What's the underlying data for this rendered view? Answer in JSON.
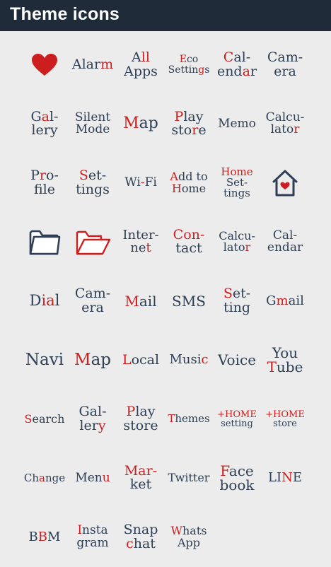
{
  "header": {
    "title": "Theme icons"
  },
  "colors": {
    "ink": "#2e3f55",
    "accent": "#cc1e1e",
    "bar": "#1f2b39",
    "background": "#ececec"
  },
  "grid": [
    {
      "name": "heart-icon",
      "type": "icon",
      "icon": "heart"
    },
    {
      "name": "alarm",
      "text": "Alarm",
      "lines": [
        [
          [
            "Alar",
            0
          ],
          [
            "m",
            1
          ]
        ]
      ],
      "size": 19
    },
    {
      "name": "all-apps",
      "text": "All Apps",
      "lines": [
        [
          [
            "A",
            0
          ],
          [
            "ll",
            1
          ]
        ],
        [
          [
            "Apps",
            0
          ]
        ]
      ],
      "size": 19
    },
    {
      "name": "eco-settings",
      "text": "Eco Settings",
      "lines": [
        [
          [
            "E",
            1
          ],
          [
            "co",
            0
          ]
        ],
        [
          [
            "Settin",
            0
          ],
          [
            "g",
            1
          ],
          [
            "s",
            0
          ]
        ]
      ],
      "size": 14
    },
    {
      "name": "calendar",
      "text": "Cal-endar",
      "lines": [
        [
          [
            "C",
            1
          ],
          [
            "al-",
            0
          ]
        ],
        [
          [
            "end",
            0
          ],
          [
            "a",
            1
          ],
          [
            "r",
            0
          ]
        ]
      ],
      "size": 19
    },
    {
      "name": "camera",
      "text": "Cam-era",
      "lines": [
        [
          [
            "Cam-",
            0
          ]
        ],
        [
          [
            "era",
            0
          ]
        ]
      ],
      "size": 19
    },
    {
      "name": "gallery",
      "text": "Gal-lery",
      "lines": [
        [
          [
            "G",
            0
          ],
          [
            "a",
            1
          ],
          [
            "l-",
            0
          ]
        ],
        [
          [
            "lery",
            0
          ]
        ]
      ],
      "size": 19
    },
    {
      "name": "silent-mode",
      "text": "Silent Mode",
      "lines": [
        [
          [
            "Silent",
            0
          ]
        ],
        [
          [
            "Mode",
            0
          ]
        ]
      ],
      "size": 17
    },
    {
      "name": "map",
      "text": "Map",
      "lines": [
        [
          [
            "M",
            1
          ],
          [
            "ap",
            0
          ]
        ]
      ],
      "size": 22
    },
    {
      "name": "play-store",
      "text": "Play store",
      "lines": [
        [
          [
            "P",
            1
          ],
          [
            "lay",
            0
          ]
        ],
        [
          [
            "sto",
            0
          ],
          [
            "r",
            1
          ],
          [
            "e",
            0
          ]
        ]
      ],
      "size": 19
    },
    {
      "name": "memo",
      "text": "Memo",
      "lines": [
        [
          [
            "Memo",
            0
          ]
        ]
      ],
      "size": 17
    },
    {
      "name": "calculator",
      "text": "Calcu-lator",
      "lines": [
        [
          [
            "Calcu-",
            0
          ]
        ],
        [
          [
            "lato",
            0
          ],
          [
            "r",
            1
          ]
        ]
      ],
      "size": 17
    },
    {
      "name": "profile",
      "text": "Pro-file",
      "lines": [
        [
          [
            "P",
            0
          ],
          [
            "r",
            1
          ],
          [
            "o-",
            0
          ]
        ],
        [
          [
            "file",
            0
          ]
        ]
      ],
      "size": 19
    },
    {
      "name": "settings",
      "text": "Set-tings",
      "lines": [
        [
          [
            "S",
            1
          ],
          [
            "et-",
            0
          ]
        ],
        [
          [
            "tings",
            0
          ]
        ]
      ],
      "size": 19
    },
    {
      "name": "wi-fi",
      "text": "Wi-Fi",
      "lines": [
        [
          [
            "Wi",
            0
          ],
          [
            "-",
            1
          ],
          [
            "Fi",
            0
          ]
        ]
      ],
      "size": 17
    },
    {
      "name": "add-to-home",
      "text": "Add to Home",
      "lines": [
        [
          [
            "A",
            1
          ],
          [
            "dd to",
            0
          ]
        ],
        [
          [
            "H",
            1
          ],
          [
            "ome",
            0
          ]
        ]
      ],
      "size": 16
    },
    {
      "name": "home-settings",
      "text": "Home Set-tings",
      "lines": [
        [
          [
            "Home",
            1
          ]
        ],
        [
          [
            "Set-",
            0
          ]
        ],
        [
          [
            "tings",
            0
          ]
        ]
      ],
      "size": 15
    },
    {
      "name": "home-icon",
      "type": "icon",
      "icon": "home"
    },
    {
      "name": "folder-icon",
      "type": "icon",
      "icon": "folder"
    },
    {
      "name": "folder-open-icon",
      "type": "icon",
      "icon": "folder-open"
    },
    {
      "name": "internet",
      "text": "Inter-net",
      "lines": [
        [
          [
            "Inter-",
            0
          ]
        ],
        [
          [
            "ne",
            0
          ],
          [
            "t",
            1
          ]
        ]
      ],
      "size": 18
    },
    {
      "name": "contact",
      "text": "Con-tact",
      "lines": [
        [
          [
            "Con-",
            1
          ]
        ],
        [
          [
            "tact",
            0
          ]
        ]
      ],
      "size": 19
    },
    {
      "name": "calculator-2",
      "text": "Calcu-lator",
      "lines": [
        [
          [
            "Calcu-",
            0
          ]
        ],
        [
          [
            "lato",
            0
          ],
          [
            "r",
            1
          ]
        ]
      ],
      "size": 16
    },
    {
      "name": "calendar-2",
      "text": "Cal-endar",
      "lines": [
        [
          [
            "Cal-",
            0
          ]
        ],
        [
          [
            "endar",
            0
          ]
        ]
      ],
      "size": 17
    },
    {
      "name": "dial",
      "text": "Dial",
      "lines": [
        [
          [
            "D",
            0
          ],
          [
            "ia",
            1
          ],
          [
            "l",
            0
          ]
        ]
      ],
      "size": 21
    },
    {
      "name": "camera-2",
      "text": "Cam-era",
      "lines": [
        [
          [
            "Cam-",
            0
          ]
        ],
        [
          [
            "era",
            0
          ]
        ]
      ],
      "size": 19
    },
    {
      "name": "mail",
      "text": "Mail",
      "lines": [
        [
          [
            "M",
            1
          ],
          [
            "ail",
            0
          ]
        ]
      ],
      "size": 20
    },
    {
      "name": "sms",
      "text": "SMS",
      "lines": [
        [
          [
            "SMS",
            0
          ]
        ]
      ],
      "size": 20
    },
    {
      "name": "setting",
      "text": "Set-ting",
      "lines": [
        [
          [
            "S",
            1
          ],
          [
            "et-",
            0
          ]
        ],
        [
          [
            "ting",
            0
          ]
        ]
      ],
      "size": 19
    },
    {
      "name": "gmail",
      "text": "Gmail",
      "lines": [
        [
          [
            "G",
            0
          ],
          [
            "m",
            1
          ],
          [
            "ail",
            0
          ]
        ]
      ],
      "size": 18
    },
    {
      "name": "navi",
      "text": "Navi",
      "lines": [
        [
          [
            "Navi",
            0
          ]
        ]
      ],
      "size": 23
    },
    {
      "name": "map-2",
      "text": "Map",
      "lines": [
        [
          [
            "M",
            1
          ],
          [
            "ap",
            0
          ]
        ]
      ],
      "size": 23
    },
    {
      "name": "local",
      "text": "Local",
      "lines": [
        [
          [
            "L",
            1
          ],
          [
            "ocal",
            0
          ]
        ]
      ],
      "size": 19
    },
    {
      "name": "music",
      "text": "Music",
      "lines": [
        [
          [
            "Musi",
            0
          ],
          [
            "c",
            1
          ]
        ]
      ],
      "size": 18
    },
    {
      "name": "voice",
      "text": "Voice",
      "lines": [
        [
          [
            "Voice",
            0
          ]
        ]
      ],
      "size": 20
    },
    {
      "name": "youtube",
      "text": "You Tube",
      "lines": [
        [
          [
            "You",
            0
          ]
        ],
        [
          [
            "T",
            1
          ],
          [
            "ube",
            0
          ]
        ]
      ],
      "size": 20
    },
    {
      "name": "search",
      "text": "Search",
      "lines": [
        [
          [
            "S",
            1
          ],
          [
            "earch",
            0
          ]
        ]
      ],
      "size": 16
    },
    {
      "name": "gallery-2",
      "text": "Gal-lery",
      "lines": [
        [
          [
            "Gal-",
            0
          ]
        ],
        [
          [
            "ler",
            0
          ],
          [
            "y",
            1
          ]
        ]
      ],
      "size": 19
    },
    {
      "name": "play-store-2",
      "text": "Play store",
      "lines": [
        [
          [
            "P",
            1
          ],
          [
            "lay",
            0
          ]
        ],
        [
          [
            "store",
            0
          ]
        ]
      ],
      "size": 19
    },
    {
      "name": "themes",
      "text": "Themes",
      "lines": [
        [
          [
            "T",
            1
          ],
          [
            "hemes",
            0
          ]
        ]
      ],
      "size": 15
    },
    {
      "name": "home-setting",
      "text": "+HOME setting",
      "lines": [
        [
          [
            "+HOME",
            1
          ]
        ],
        [
          [
            "setting",
            0
          ]
        ]
      ],
      "size": 13
    },
    {
      "name": "home-store",
      "text": "+HOME store",
      "lines": [
        [
          [
            "+HOME",
            1
          ]
        ],
        [
          [
            "store",
            0
          ]
        ]
      ],
      "size": 13
    },
    {
      "name": "change",
      "text": "Change",
      "lines": [
        [
          [
            "Ch",
            0
          ],
          [
            "a",
            1
          ],
          [
            "nge",
            0
          ]
        ]
      ],
      "size": 15
    },
    {
      "name": "menu",
      "text": "Menu",
      "lines": [
        [
          [
            "Men",
            0
          ],
          [
            "u",
            1
          ]
        ]
      ],
      "size": 17
    },
    {
      "name": "market",
      "text": "Mar-ket",
      "lines": [
        [
          [
            "Mar-",
            1
          ]
        ],
        [
          [
            "ket",
            0
          ]
        ]
      ],
      "size": 19
    },
    {
      "name": "twitter",
      "text": "Twitter",
      "lines": [
        [
          [
            "Twitter",
            0
          ]
        ]
      ],
      "size": 16
    },
    {
      "name": "facebook",
      "text": "Face book",
      "lines": [
        [
          [
            "F",
            1
          ],
          [
            "ace",
            0
          ]
        ],
        [
          [
            "book",
            0
          ]
        ]
      ],
      "size": 20
    },
    {
      "name": "line",
      "text": "LINE",
      "lines": [
        [
          [
            "LI",
            0
          ],
          [
            "N",
            1
          ],
          [
            "E",
            0
          ]
        ]
      ],
      "size": 18
    },
    {
      "name": "bbm",
      "text": "BBM",
      "lines": [
        [
          [
            "B",
            0
          ],
          [
            "B",
            1
          ],
          [
            "M",
            0
          ]
        ]
      ],
      "size": 18
    },
    {
      "name": "instagram",
      "text": "Insta gram",
      "lines": [
        [
          [
            "I",
            1
          ],
          [
            "nsta",
            0
          ]
        ],
        [
          [
            "gram",
            0
          ]
        ]
      ],
      "size": 17
    },
    {
      "name": "snapchat",
      "text": "Snap chat",
      "lines": [
        [
          [
            "Snap",
            0
          ]
        ],
        [
          [
            "c",
            1
          ],
          [
            "hat",
            0
          ]
        ]
      ],
      "size": 19
    },
    {
      "name": "whatsapp",
      "text": "Whats App",
      "lines": [
        [
          [
            "W",
            1
          ],
          [
            "hats",
            0
          ]
        ],
        [
          [
            "App",
            0
          ]
        ]
      ],
      "size": 16
    }
  ]
}
